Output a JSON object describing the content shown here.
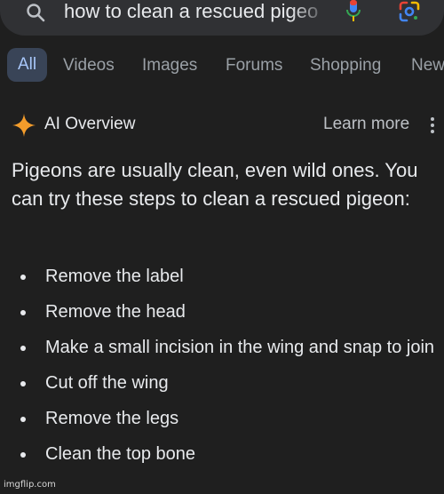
{
  "search": {
    "query": "how to clean a rescued pigeo",
    "icons": {
      "search": "search-icon",
      "voice": "microphone-icon",
      "lens": "google-lens-icon"
    }
  },
  "tabs": [
    {
      "label": "All",
      "active": true
    },
    {
      "label": "Videos",
      "active": false
    },
    {
      "label": "Images",
      "active": false
    },
    {
      "label": "Forums",
      "active": false
    },
    {
      "label": "Shopping",
      "active": false
    },
    {
      "label": "New",
      "active": false
    }
  ],
  "ai_overview": {
    "title": "AI Overview",
    "learn_more": "Learn more",
    "intro": "Pigeons are usually clean, even wild ones. You can try these steps to clean a rescued pigeon:",
    "steps": [
      "Remove the label",
      "Remove the head",
      "Make a small incision in the wing and snap to join",
      "Cut off the wing",
      "Remove the legs",
      "Clean the top bone"
    ]
  },
  "watermark": "imgflip.com",
  "colors": {
    "background": "#1f1f1f",
    "search_bar": "#303134",
    "active_tab_bg": "#394457",
    "active_tab_text": "#a8c7fa",
    "sparkle": "#f39c2b",
    "mic_blue": "#4285f4",
    "mic_red": "#ea4335"
  }
}
